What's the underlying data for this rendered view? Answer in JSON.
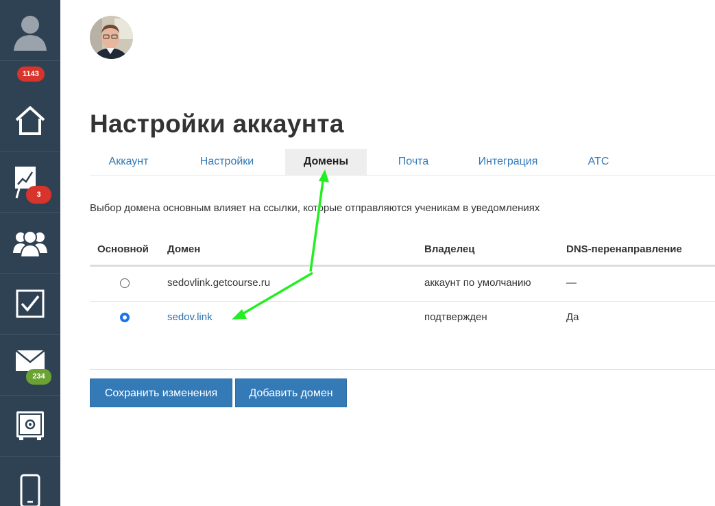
{
  "sidebar": {
    "items": [
      {
        "icon": "user-icon"
      },
      {
        "icon": "home-icon"
      },
      {
        "icon": "chart-board-icon"
      },
      {
        "icon": "users-group-icon"
      },
      {
        "icon": "checkbox-icon"
      },
      {
        "icon": "mail-icon"
      },
      {
        "icon": "safe-icon"
      },
      {
        "icon": "mobile-phone-icon"
      }
    ],
    "badges": {
      "notifications": "1143",
      "sales": "3",
      "messages": "234"
    },
    "colors": {
      "background": "#2f4254",
      "badge_red": "#d9342b",
      "badge_green": "#6aa333"
    }
  },
  "page": {
    "title": "Настройки аккаунта",
    "description": "Выбор домена основным влияет на ссылки, которые отправляются ученикам в уведомлениях"
  },
  "tabs": [
    {
      "label": "Аккаунт",
      "active": false
    },
    {
      "label": "Настройки",
      "active": false
    },
    {
      "label": "Домены",
      "active": true
    },
    {
      "label": "Почта",
      "active": false
    },
    {
      "label": "Интеграция",
      "active": false
    },
    {
      "label": "АТС",
      "active": false
    }
  ],
  "table": {
    "headers": {
      "primary": "Основной",
      "domain": "Домен",
      "owner": "Владелец",
      "dns": "DNS-перенаправление"
    },
    "rows": [
      {
        "primary": false,
        "domain": "sedovlink.getcourse.ru",
        "owner": "аккаунт по умолчанию",
        "dns": "—"
      },
      {
        "primary": true,
        "domain": "sedov.link",
        "owner": "подтвержден",
        "dns": "Да"
      }
    ]
  },
  "buttons": {
    "save": "Сохранить изменения",
    "add_domain": "Добавить домен"
  },
  "colors": {
    "accent": "#337ab7",
    "link": "#2a6fb0",
    "annotation_arrow": "#22ee22"
  }
}
